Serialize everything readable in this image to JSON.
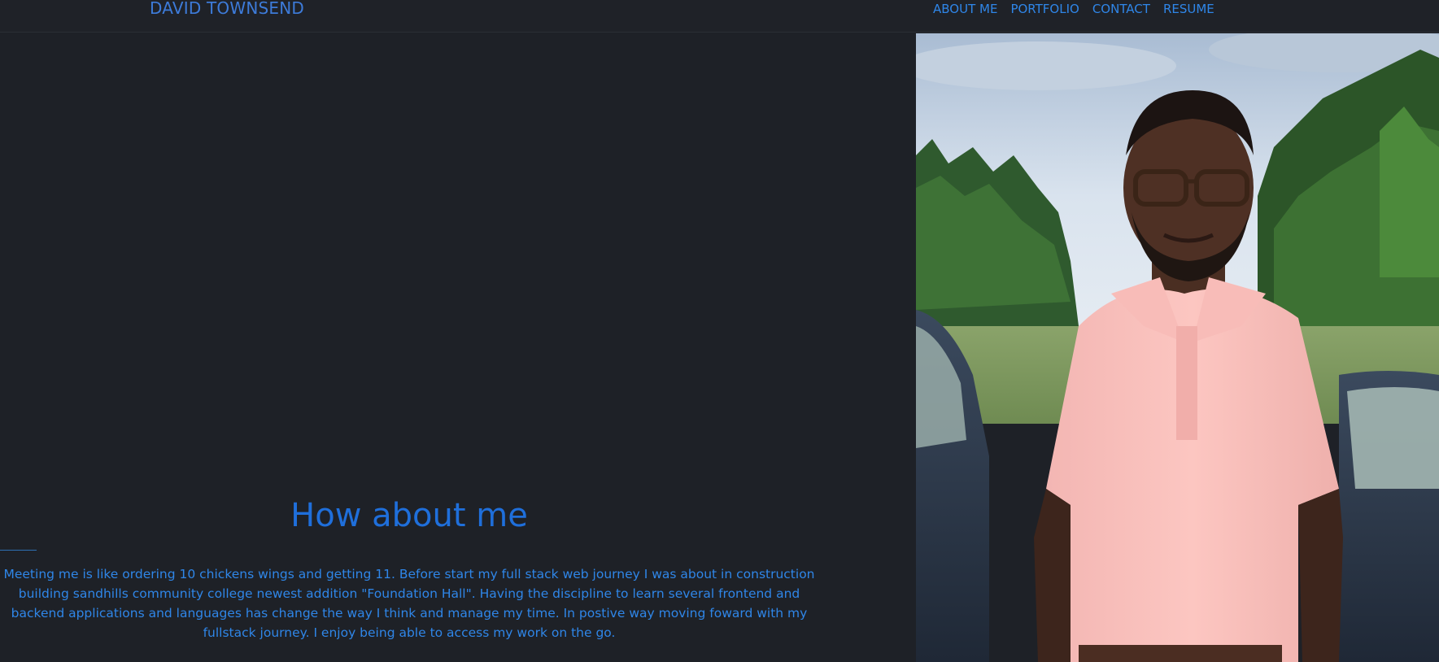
{
  "header": {
    "brand": "DAVID TOWNSEND",
    "nav": [
      {
        "label": "ABOUT ME"
      },
      {
        "label": "PORTFOLIO"
      },
      {
        "label": "CONTACT"
      },
      {
        "label": "RESUME"
      }
    ]
  },
  "about": {
    "title": "How about me",
    "text": "Meeting me is like ordering 10 chickens wings and getting 11. Before start my full stack web journey I was about in construction building sandhills community college newest addition \"Foundation Hall\". Having the discipline to learn several frontend and backend applications and languages has change the way I think and manage my time. In postive way moving foward with my fullstack journey. I enjoy being able to access my work on the go."
  },
  "colors": {
    "background": "#1e2127",
    "accent": "#2f86e8",
    "title": "#1f6fdb"
  }
}
